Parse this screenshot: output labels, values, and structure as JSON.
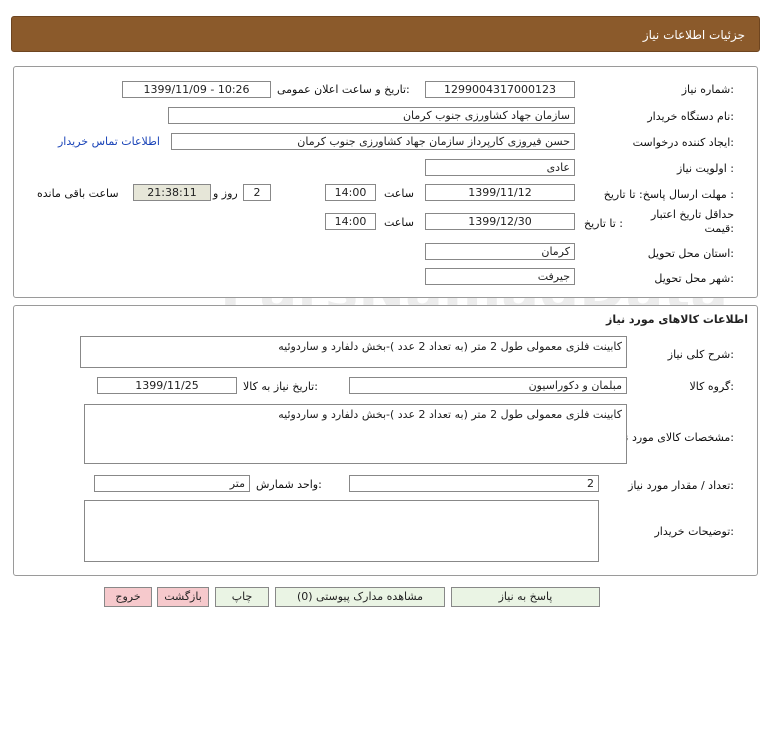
{
  "header": {
    "title": "جزئیات اطلاعات نیاز"
  },
  "request": {
    "need_number_label": "شماره نیاز:",
    "need_number": "1299004317000123",
    "announce_label": "تاریخ و ساعت اعلان عمومی:",
    "announce_value": "1399/11/09 - 10:26",
    "buyer_org_label": "نام دستگاه خریدار:",
    "buyer_org": "سازمان جهاد کشاورزی جنوب کرمان",
    "creator_label": "ایجاد کننده درخواست:",
    "creator": "حسن فیروزی کارپرداز سازمان جهاد کشاورزی جنوب کرمان",
    "contact_link": "اطلاعات تماس خریدار",
    "priority_label": "اولویت نیاز :",
    "priority": "عادی",
    "deadline_label": "مهلت ارسال پاسخ: تا تاریخ :",
    "deadline_date": "1399/11/12",
    "time_label": "ساعت",
    "deadline_time": "14:00",
    "days_remaining": "2",
    "days_and_label": "روز و",
    "time_remaining": "21:38:11",
    "remaining_label": "ساعت باقی مانده",
    "price_validity_label": "حداقل تاریخ اعتبار قیمت:",
    "to_date_label": "تا تاریخ :",
    "price_validity_date": "1399/12/30",
    "price_validity_time": "14:00",
    "province_label": "استان محل تحویل:",
    "province": "کرمان",
    "city_label": "شهر محل تحویل:",
    "city": "جیرفت"
  },
  "goods": {
    "section_title": "اطلاعات کالاهای مورد نیاز",
    "general_desc_label": "شرح کلی نیاز:",
    "general_desc": "کابینت فلزی معمولی طول 2 متر (به تعداد 2 عدد )-بخش دلفارد و ساردوئیه",
    "group_label": "گروه کالا:",
    "group": "مبلمان و دکوراسیون",
    "need_date_label": "تاریخ نیاز به کالا:",
    "need_date": "1399/11/25",
    "specs_label": "مشخصات کالای مورد نیاز:",
    "specs": "کابینت فلزی معمولی طول 2 متر (به تعداد 2 عدد )-بخش دلفارد و ساردوئیه",
    "qty_label": "تعداد / مقدار مورد نیاز:",
    "qty": "2",
    "unit_label": "واحد شمارش:",
    "unit": "متر",
    "buyer_notes_label": "توضیحات خریدار:",
    "buyer_notes": ""
  },
  "buttons": {
    "reply": "پاسخ به نیاز",
    "attachments": "مشاهده مدارک پیوستی (0)",
    "print": "چاپ",
    "back": "بازگشت",
    "exit": "خروج"
  },
  "watermark": {
    "brand": "ParsNamadData",
    "line1": "مرکز فرآوری اطلاعات پارس نماد داده ها",
    "line2": "پایگاه اطلاع رسانی مناقصه و مزایده",
    "phone": "۰۲۱-۸۸۳۴۹۶۷۰-۵"
  }
}
